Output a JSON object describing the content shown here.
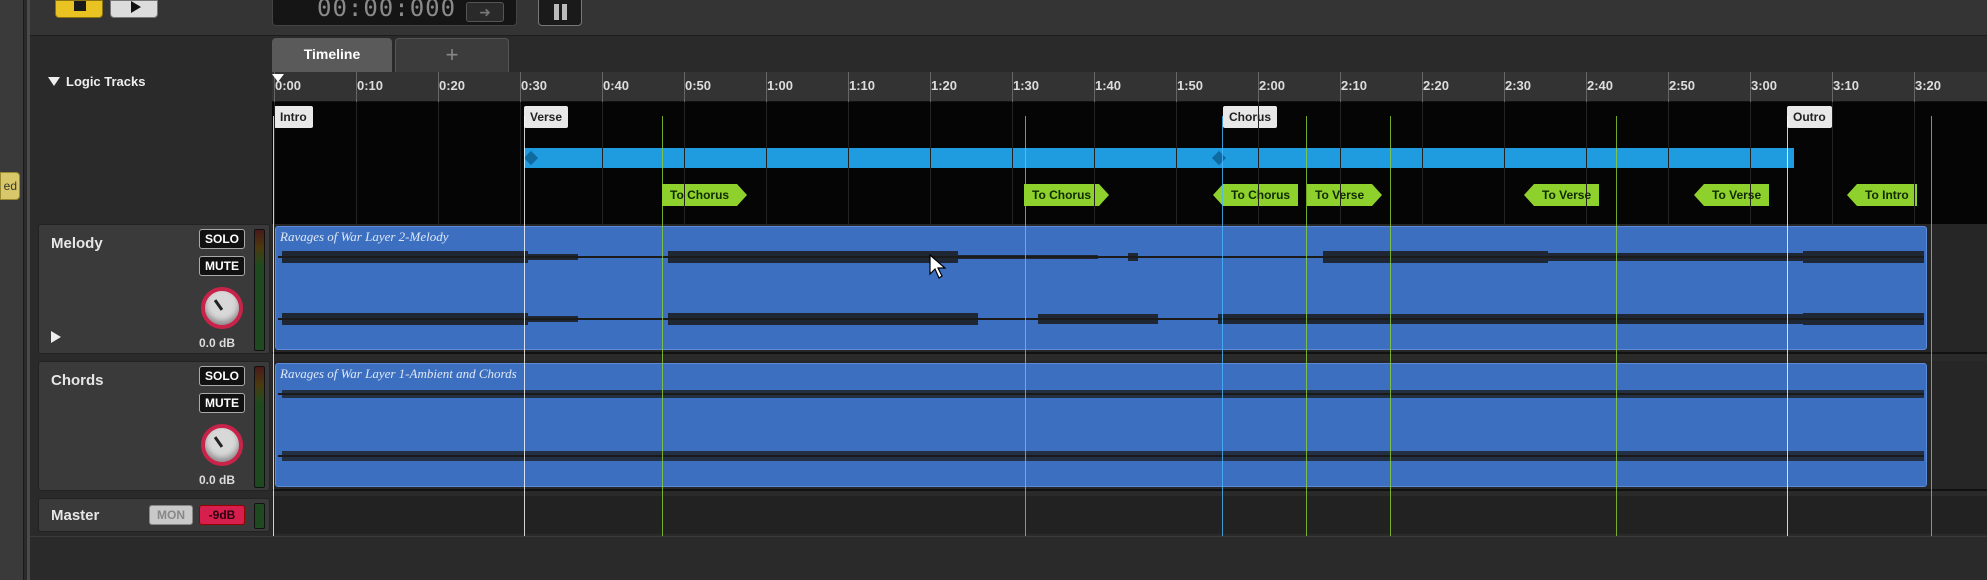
{
  "left_strip": {
    "tab_label": "ed"
  },
  "transport": {
    "time": "00:00:000",
    "arrow": "➜"
  },
  "tabs": [
    {
      "label": "Timeline"
    },
    {
      "label": "+"
    }
  ],
  "tracks_header": {
    "label": "Logic Tracks"
  },
  "ruler": {
    "ticks": [
      "0:00",
      "0:10",
      "0:20",
      "0:30",
      "0:40",
      "0:50",
      "1:00",
      "1:10",
      "1:20",
      "1:30",
      "1:40",
      "1:50",
      "2:00",
      "2:10",
      "2:20",
      "2:30",
      "2:40",
      "2:50",
      "3:00",
      "3:10",
      "3:20"
    ]
  },
  "sections": [
    {
      "label": "Intro"
    },
    {
      "label": "Verse"
    },
    {
      "label": "Chorus"
    },
    {
      "label": "Outro"
    }
  ],
  "jumps": [
    {
      "label": "To Chorus"
    },
    {
      "label": "To Chorus"
    },
    {
      "label": "To Chorus"
    },
    {
      "label": "To Verse"
    },
    {
      "label": "To Verse"
    },
    {
      "label": "To Verse"
    },
    {
      "label": "To Intro"
    }
  ],
  "tracks": [
    {
      "name": "Melody",
      "solo": "SOLO",
      "mute": "MUTE",
      "db": "0.0 dB",
      "clip": "Ravages of War Layer 2-Melody"
    },
    {
      "name": "Chords",
      "solo": "SOLO",
      "mute": "MUTE",
      "db": "0.0 dB",
      "clip": "Ravages of War Layer 1-Ambient and Chords"
    }
  ],
  "master": {
    "name": "Master",
    "mon": "MON",
    "db": "-9dB"
  },
  "colors": {
    "clip": "#3c6fbf",
    "loop": "#1f9be0",
    "jump": "#8fd12c",
    "stop": "#e8c321",
    "master_db": "#d61f4d"
  },
  "icons": {
    "stop": "stop-icon",
    "play": "play-icon",
    "pause": "pause-icon",
    "collapse": "triangle-down-icon",
    "expand": "triangle-right-icon",
    "cursor": "mouse-pointer-icon"
  }
}
